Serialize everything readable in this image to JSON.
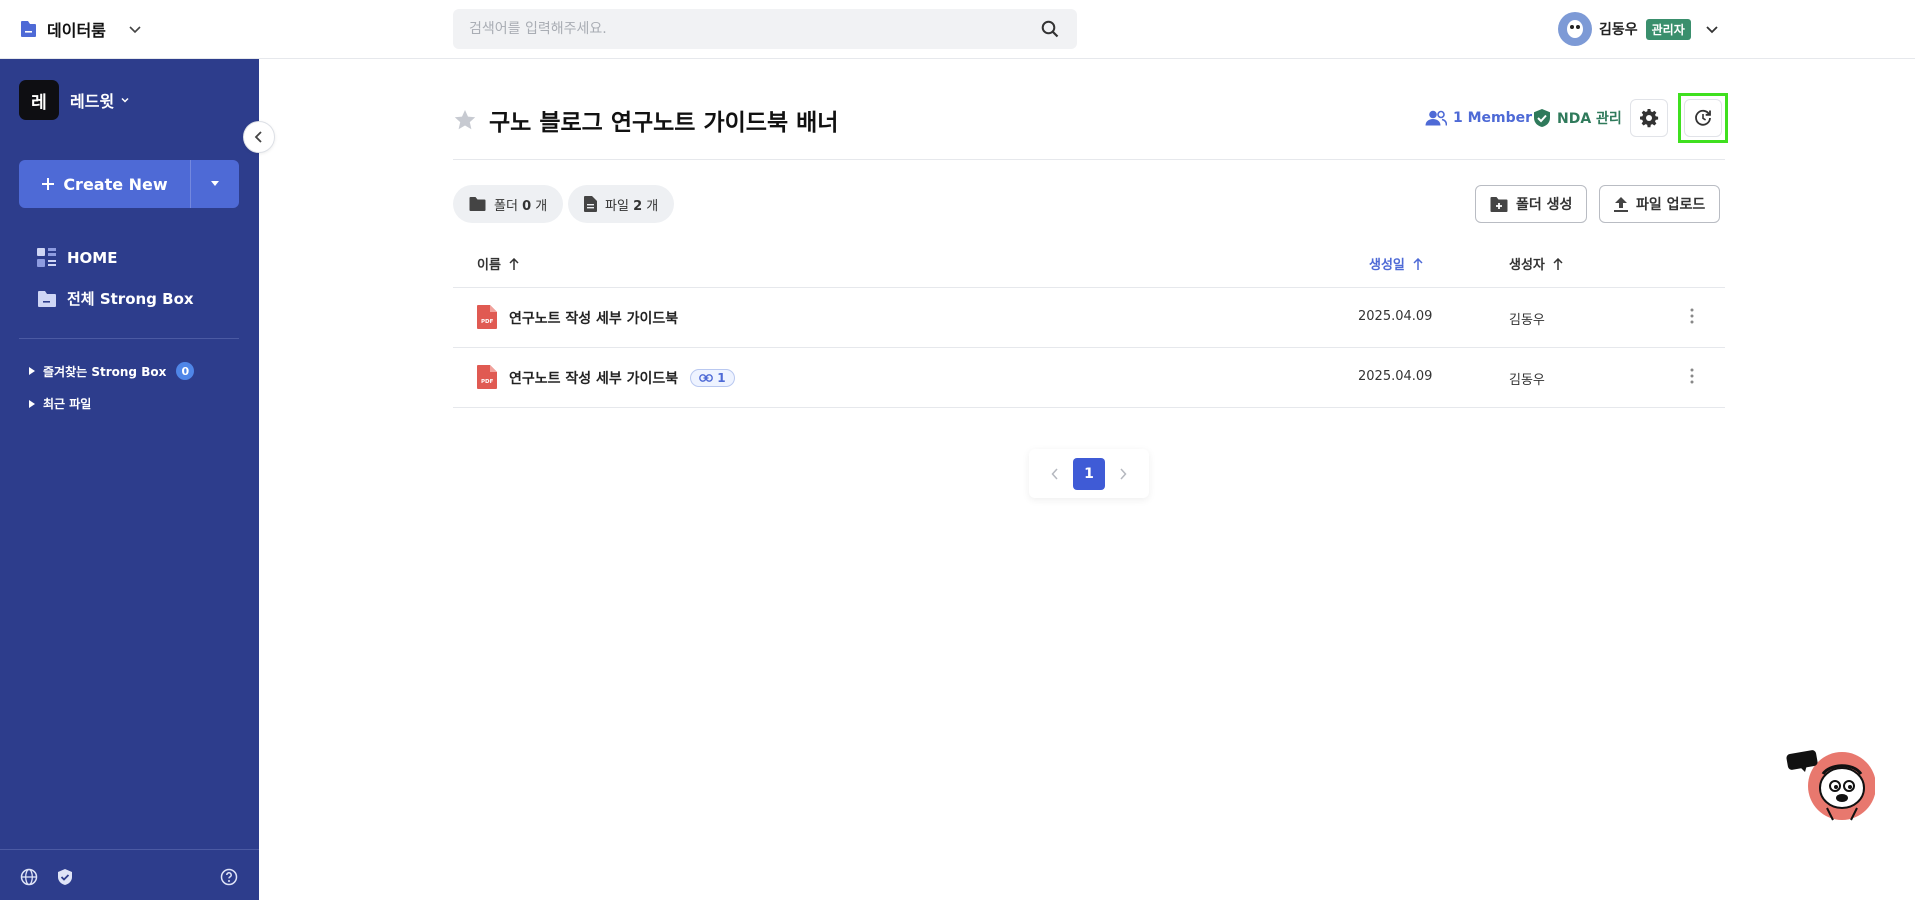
{
  "topbar": {
    "app_label": "데이터룸",
    "search_placeholder": "검색어를 입력해주세요.",
    "user_name": "김동우",
    "user_role": "관리자"
  },
  "sidebar": {
    "workspace_initial": "레",
    "workspace_name": "레드윗",
    "create_label": "Create New",
    "nav": [
      {
        "label": "HOME"
      },
      {
        "label": "전체 Strong Box"
      }
    ],
    "tree": [
      {
        "label": "즐겨찾는 Strong Box",
        "count": "0"
      },
      {
        "label": "최근 파일"
      }
    ]
  },
  "page": {
    "title": "구노 블로그 연구노트 가이드북 배너",
    "member_label": "1 Member",
    "nda_label": "NDA 관리"
  },
  "toolbar": {
    "folder_chip_prefix": "폴더",
    "folder_count": "0",
    "folder_chip_suffix": "개",
    "file_chip_prefix": "파일",
    "file_count": "2",
    "file_chip_suffix": "개",
    "create_folder_label": "폴더 생성",
    "upload_label": "파일 업로드"
  },
  "table": {
    "columns": {
      "name": "이름",
      "created": "생성일",
      "creator": "생성자"
    },
    "rows": [
      {
        "name": "연구노트 작성 세부 가이드북",
        "created": "2025.04.09",
        "creator": "김동우",
        "link_count": ""
      },
      {
        "name": "연구노트 작성 세부 가이드북",
        "created": "2025.04.09",
        "creator": "김동우",
        "link_count": "1"
      }
    ]
  },
  "pagination": {
    "current": "1"
  },
  "colors": {
    "sidebar_bg": "#2d3d8c",
    "accent": "#4e6ad6",
    "nda_green": "#2f7a5b",
    "highlight": "#3fe01f"
  }
}
